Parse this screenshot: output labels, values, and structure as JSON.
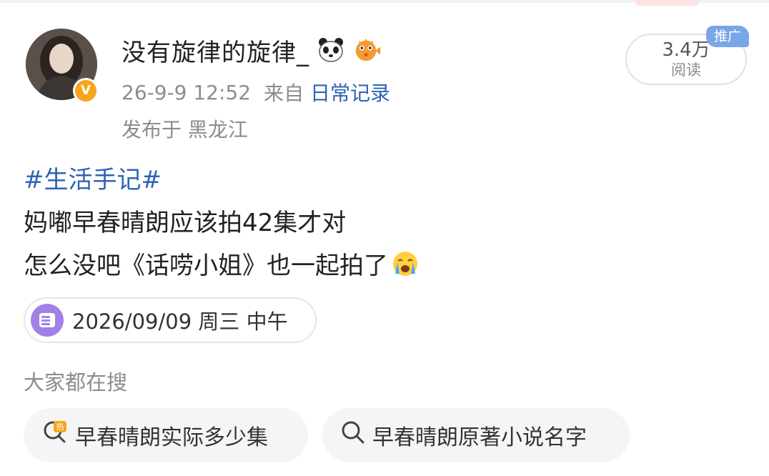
{
  "post": {
    "author": {
      "username": "没有旋律的旋律_",
      "emoji_icons": [
        "panda-icon",
        "pufferfish-icon"
      ],
      "badge": "v-verified-badge"
    },
    "meta": {
      "datetime": "26-9-9 12:52",
      "source_prefix": "来自",
      "source": "日常记录",
      "location": "发布于 黑龙江"
    },
    "reads": {
      "value": "3.4万",
      "label": "阅读",
      "promo_tag": "推广"
    },
    "hashtag": "#生活手记#",
    "lines": [
      "妈嘟早春晴朗应该拍42集才对",
      "怎么没吧《话唠小姐》也一起拍了"
    ],
    "diary_chip": {
      "icon": "diary-icon",
      "text": "2026/09/09 周三 中午"
    }
  },
  "search": {
    "heading": "大家都在搜",
    "items": [
      {
        "icon": "hot-search-icon",
        "text": "早春晴朗实际多少集"
      },
      {
        "icon": "search-icon",
        "text": "早春晴朗原著小说名字"
      }
    ]
  },
  "colors": {
    "link": "#2f63b5",
    "muted": "#8c8c8c",
    "verified": "#f7a51c",
    "promo": "#7aa6e8",
    "diary": "#a281e6"
  }
}
